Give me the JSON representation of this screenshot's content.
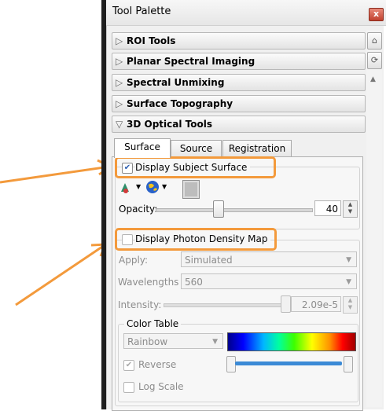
{
  "window": {
    "title": "Tool Palette",
    "close_glyph": "x"
  },
  "sections": [
    {
      "label": "ROI Tools",
      "expanded": false
    },
    {
      "label": "Planar Spectral Imaging",
      "expanded": false
    },
    {
      "label": "Spectral Unmixing",
      "expanded": false
    },
    {
      "label": "Surface Topography",
      "expanded": false
    },
    {
      "label": "3D Optical Tools",
      "expanded": true
    }
  ],
  "tabs": [
    {
      "label": "Surface",
      "active": true
    },
    {
      "label": "Source",
      "active": false
    },
    {
      "label": "Registration",
      "active": false
    }
  ],
  "surface": {
    "display_subject_surface": {
      "label": "Display Subject Surface",
      "checked": true
    },
    "opacity": {
      "label": "Opacity:",
      "value": "40",
      "level": 0.4
    }
  },
  "photon_density": {
    "display_map": {
      "label": "Display Photon Density Map",
      "checked": false
    },
    "apply": {
      "label": "Apply:",
      "value": "Simulated"
    },
    "wavelengths": {
      "label": "Wavelengths",
      "value": "560"
    },
    "intensity": {
      "label": "Intensity:",
      "value": "2.09e-5"
    },
    "color_table": {
      "title": "Color Table",
      "scheme": "Rainbow",
      "reverse": {
        "label": "Reverse",
        "checked": true
      },
      "log_scale": {
        "label": "Log Scale",
        "checked": false
      }
    }
  },
  "colors": {
    "highlight": "#f39a3c",
    "arrow": "#f39a3c"
  }
}
